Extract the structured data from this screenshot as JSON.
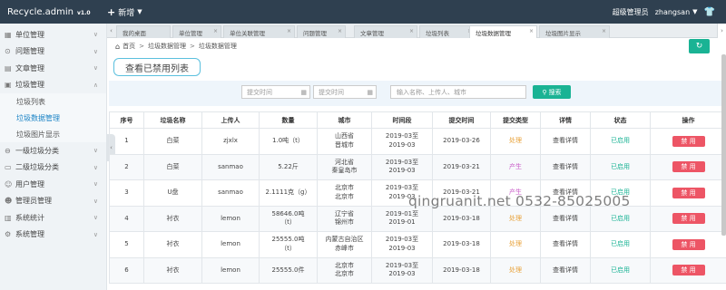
{
  "app": {
    "name": "Recycle.admin",
    "version": "v1.0",
    "new_label": "新增"
  },
  "header": {
    "role": "超级管理员",
    "username": "zhangsan"
  },
  "sidebar": {
    "items": [
      {
        "label": "单位管理"
      },
      {
        "label": "问题管理"
      },
      {
        "label": "文章管理"
      },
      {
        "label": "垃圾管理"
      },
      {
        "label": "一级垃圾分类"
      },
      {
        "label": "二级垃圾分类"
      },
      {
        "label": "用户管理"
      },
      {
        "label": "管理员管理"
      },
      {
        "label": "系统统计"
      },
      {
        "label": "系统管理"
      }
    ],
    "sub_items": [
      {
        "label": "垃圾列表"
      },
      {
        "label": "垃圾数据管理"
      },
      {
        "label": "垃圾图片显示"
      }
    ]
  },
  "tabs": [
    {
      "label": "我的桌面"
    },
    {
      "label": "单位管理"
    },
    {
      "label": "单位关联管理"
    },
    {
      "label": "问题管理"
    },
    {
      "label": "文章管理"
    },
    {
      "label": "垃圾列表"
    },
    {
      "label": "垃圾数据管理"
    },
    {
      "label": "垃圾图片显示"
    }
  ],
  "breadcrumb": {
    "home": "首页",
    "level1": "垃圾数据管理",
    "level2": "垃圾数据管理"
  },
  "toolbar": {
    "view_disabled_label": "查看已禁用列表"
  },
  "filters": {
    "date_start_placeholder": "提交时间",
    "date_end_placeholder": "提交时间",
    "search_placeholder": "输入名称、上传人、城市",
    "search_label": "搜索"
  },
  "table": {
    "headers": [
      "序号",
      "垃圾名称",
      "上传人",
      "数量",
      "城市",
      "时间段",
      "提交时间",
      "提交类型",
      "详情",
      "状态",
      "操作"
    ],
    "rows": [
      {
        "id": "1",
        "name": "白菜",
        "uploader": "zjxlx",
        "qty1": "1.0吨（t）",
        "qty2": "",
        "city1": "山西省",
        "city2": "晋城市",
        "period1": "2019-03至",
        "period2": "2019-03",
        "submit": "2019-03-26",
        "type": "处理",
        "detail": "查看详情",
        "status": "已启用",
        "action": "禁 用"
      },
      {
        "id": "2",
        "name": "白菜",
        "uploader": "sanmao",
        "qty1": "5.22斤",
        "qty2": "",
        "city1": "河北省",
        "city2": "秦皇岛市",
        "period1": "2019-03至",
        "period2": "2019-03",
        "submit": "2019-03-21",
        "type": "产生",
        "detail": "查看详情",
        "status": "已启用",
        "action": "禁 用"
      },
      {
        "id": "3",
        "name": "U盘",
        "uploader": "sanmao",
        "qty1": "2.1111克（g）",
        "qty2": "",
        "city1": "北京市",
        "city2": "北京市",
        "period1": "2019-03至",
        "period2": "2019-03",
        "submit": "2019-03-21",
        "type": "产生",
        "detail": "查看详情",
        "status": "已启用",
        "action": "禁 用"
      },
      {
        "id": "4",
        "name": "衬衣",
        "uploader": "lemon",
        "qty1": "58646.0吨",
        "qty2": "（t）",
        "city1": "辽宁省",
        "city2": "锦州市",
        "period1": "2019-01至",
        "period2": "2019-01",
        "submit": "2019-03-18",
        "type": "处理",
        "detail": "查看详情",
        "status": "已启用",
        "action": "禁 用"
      },
      {
        "id": "5",
        "name": "衬衣",
        "uploader": "lemon",
        "qty1": "25555.0吨",
        "qty2": "（t）",
        "city1": "内蒙古自治区",
        "city2": "赤峰市",
        "period1": "2019-03至",
        "period2": "2019-03",
        "submit": "2019-03-18",
        "type": "处理",
        "detail": "查看详情",
        "status": "已启用",
        "action": "禁 用"
      },
      {
        "id": "6",
        "name": "衬衣",
        "uploader": "lemon",
        "qty1": "25555.0件",
        "qty2": "",
        "city1": "北京市",
        "city2": "北京市",
        "period1": "2019-03至",
        "period2": "2019-03",
        "submit": "2019-03-18",
        "type": "处理",
        "detail": "查看详情",
        "status": "已启用",
        "action": "禁 用"
      }
    ]
  },
  "watermark": "qingruanit.net 0532-85025005",
  "colors": {
    "topbar": "#2f4050",
    "accent": "#1ab394",
    "danger": "#ed5565",
    "link_active": "#1c84c6",
    "type_process": "#e8a33c",
    "type_produce": "#c85ac8"
  },
  "icons": {
    "home": "home-icon",
    "refresh": "refresh-icon",
    "search": "search-icon",
    "calendar": "calendar-icon",
    "shirt": "shirt-icon"
  }
}
